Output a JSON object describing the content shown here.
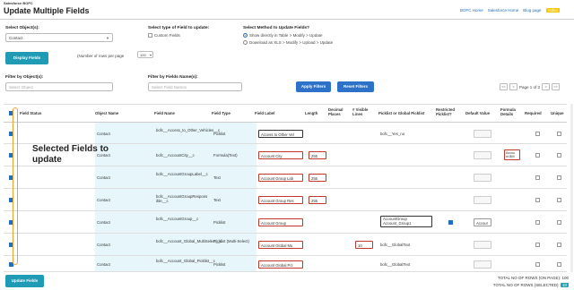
{
  "header": {
    "app_label": "Salesforce BOFC",
    "title": "Update Multiple Fields",
    "links": [
      "BOFC Home",
      "Salesforce Home",
      "Blog page",
      "Video"
    ]
  },
  "objects": {
    "label": "Select Object(s):",
    "value": "Contact"
  },
  "field_type": {
    "label": "Select type of Field to update:",
    "option": "Custom Fields"
  },
  "method": {
    "label": "Select Method to Update Fields?",
    "options": [
      "Show directly in Table > Modify > Update",
      "Download as XLS > Modify > Upload > Update"
    ]
  },
  "display_button": "Display Fields",
  "rows_per_page": {
    "label": "(Number of rows per page",
    "value": "100"
  },
  "filter_objects": {
    "label": "Filter by Object(s):",
    "placeholder": "Select Object"
  },
  "filter_fields": {
    "label": "Filter by Fields Name(s):",
    "placeholder": "Select Field Names"
  },
  "apply_filters": "Apply Filters",
  "reset_filters": "Reset Filters",
  "pager": {
    "text": "Page 1 of 3",
    "prev2": "<<",
    "prev": "<",
    "next": ">",
    "next2": ">>"
  },
  "table": {
    "columns": [
      "Field Status",
      "Object Name",
      "Field Name",
      "Field Type",
      "Field Label",
      "Length",
      "Decimal Places",
      "# Visible Lines",
      "Picklist or Global Picklist",
      "Restricted Picklist?",
      "Default Value",
      "Formula Details",
      "Required",
      "Unique"
    ],
    "rows": [
      {
        "object": "Contact",
        "field_name": "bofc__Access_to_Other_Vehicles__c",
        "type": "Picklist",
        "label": "Access to Other Vel",
        "length": "",
        "visible": "",
        "picklist": "bofc__Yes_no",
        "formula": ""
      },
      {
        "object": "Contact",
        "field_name": "bofc__AccountCity__c",
        "type": "Formula(Text)",
        "label": "Account City",
        "length": "255",
        "visible": "",
        "picklist": "",
        "formula": "Accou nt.Billi"
      },
      {
        "object": "Contact",
        "field_name": "bofc__AccountGroupLabel__c",
        "type": "Text",
        "label": "Account Group Lab",
        "length": "255",
        "visible": "",
        "picklist": "",
        "formula": ""
      },
      {
        "object": "Contact",
        "field_name": "bofc__AccountGroupResponsible__c",
        "type": "Text",
        "label": "Account Group Res",
        "length": "255",
        "visible": "",
        "picklist": "",
        "formula": ""
      },
      {
        "object": "Contact",
        "field_name": "bofc__AccountGroup__c",
        "type": "Picklist",
        "label": "Account Group",
        "length": "",
        "visible": "",
        "picklist": "AccountGroup Account_Group1",
        "default": "Accour",
        "formula": ""
      },
      {
        "object": "Contact",
        "field_name": "bofc__Account_Global_MultiSelect__c",
        "type": "Picklist (Multi-Select)",
        "label": "Account Global Mu",
        "length": "",
        "visible": "10",
        "picklist": "bofc__GlobalText",
        "formula": ""
      },
      {
        "object": "Contact",
        "field_name": "bofc__Account_Global_Picklist__c",
        "type": "Picklist",
        "label": "Account Global Pcl",
        "length": "",
        "visible": "",
        "picklist": "bofc__GlobalText",
        "formula": ""
      }
    ]
  },
  "annotation": "Selected Fields to update",
  "update_button": "Update Fields",
  "totals": {
    "on_pages_label": "TOTAL NO OF ROWS (ON PAGE):",
    "on_pages_value": "100",
    "selected_label": "TOTAL NO OF ROWS (SELECTED):",
    "selected_value": "10"
  },
  "colors": {
    "accent": "#1f9bb5",
    "primary": "#2d72c8",
    "highlight": "#f0a030",
    "row_fill": "#e6f6fb"
  }
}
